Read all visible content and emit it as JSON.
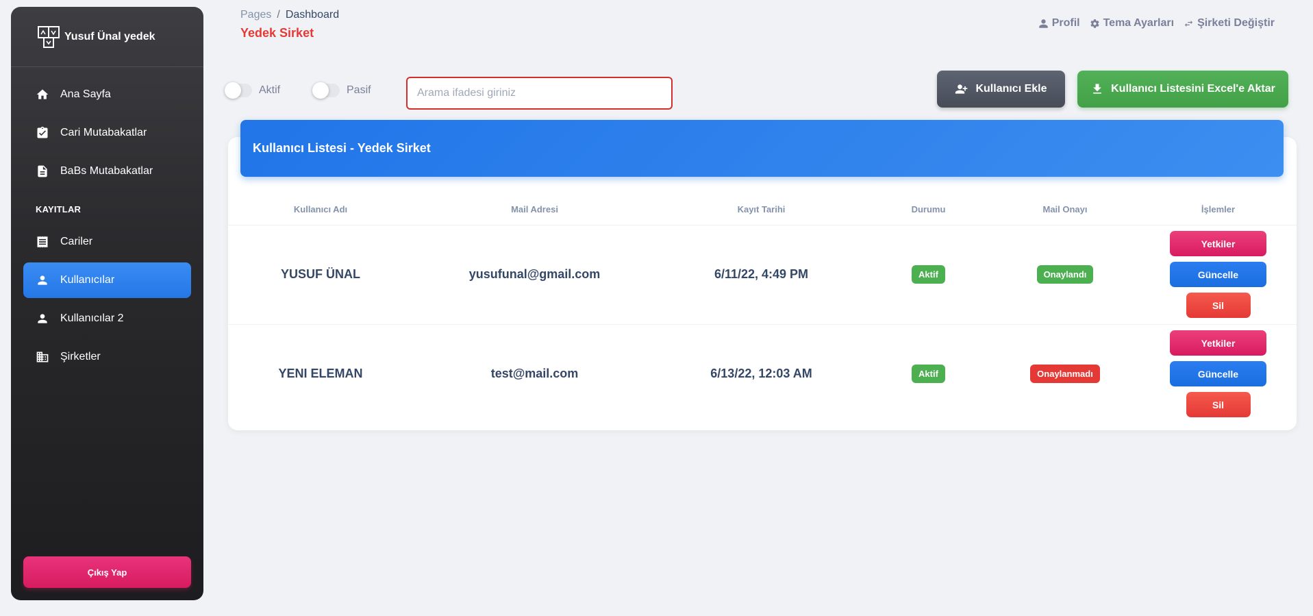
{
  "sidebar": {
    "brand": "Yusuf Ünal yedek",
    "items": [
      {
        "label": "Ana Sayfa",
        "icon": "home-icon"
      },
      {
        "label": "Cari Mutabakatlar",
        "icon": "clipboard-check-icon"
      },
      {
        "label": "BaBs Mutabakatlar",
        "icon": "document-icon"
      }
    ],
    "section": "KAYITLAR",
    "records": [
      {
        "label": "Cariler",
        "icon": "receipt-icon"
      },
      {
        "label": "Kullanıcılar",
        "icon": "user-icon",
        "active": true
      },
      {
        "label": "Kullanıcılar 2",
        "icon": "user-icon"
      },
      {
        "label": "Şirketler",
        "icon": "building-icon"
      }
    ],
    "logout": "Çıkış Yap"
  },
  "header": {
    "breadcrumb_root": "Pages",
    "breadcrumb_sep": "/",
    "breadcrumb_current": "Dashboard",
    "title": "Yedek Sirket",
    "links": {
      "profile": "Profil",
      "theme": "Tema Ayarları",
      "company": "Şirketi Değiştir"
    }
  },
  "filters": {
    "active_label": "Aktif",
    "passive_label": "Pasif",
    "search_placeholder": "Arama ifadesi giriniz"
  },
  "buttons": {
    "add_user": "Kullanıcı Ekle",
    "export_excel": "Kullanıcı Listesini Excel'e Aktar"
  },
  "card": {
    "title": "Kullanıcı Listesi - Yedek Sirket",
    "columns": [
      "Kullanıcı Adı",
      "Mail Adresi",
      "Kayıt Tarihi",
      "Durumu",
      "Mail Onayı",
      "İşlemler"
    ],
    "rows": [
      {
        "name": "YUSUF ÜNAL",
        "email": "yusufunal@gmail.com",
        "date": "6/11/22, 4:49 PM",
        "status": "Aktif",
        "mail_status": "Onaylandı",
        "mail_ok": true
      },
      {
        "name": "YENI ELEMAN",
        "email": "test@mail.com",
        "date": "6/13/22, 12:03 AM",
        "status": "Aktif",
        "mail_status": "Onaylanmadı",
        "mail_ok": false
      }
    ],
    "actions": {
      "permissions": "Yetkiler",
      "update": "Güncelle",
      "delete": "Sil"
    }
  },
  "colors": {
    "accent_blue": "#2175e8",
    "danger": "#e53935",
    "success": "#43a047",
    "pink": "#d81b60"
  }
}
